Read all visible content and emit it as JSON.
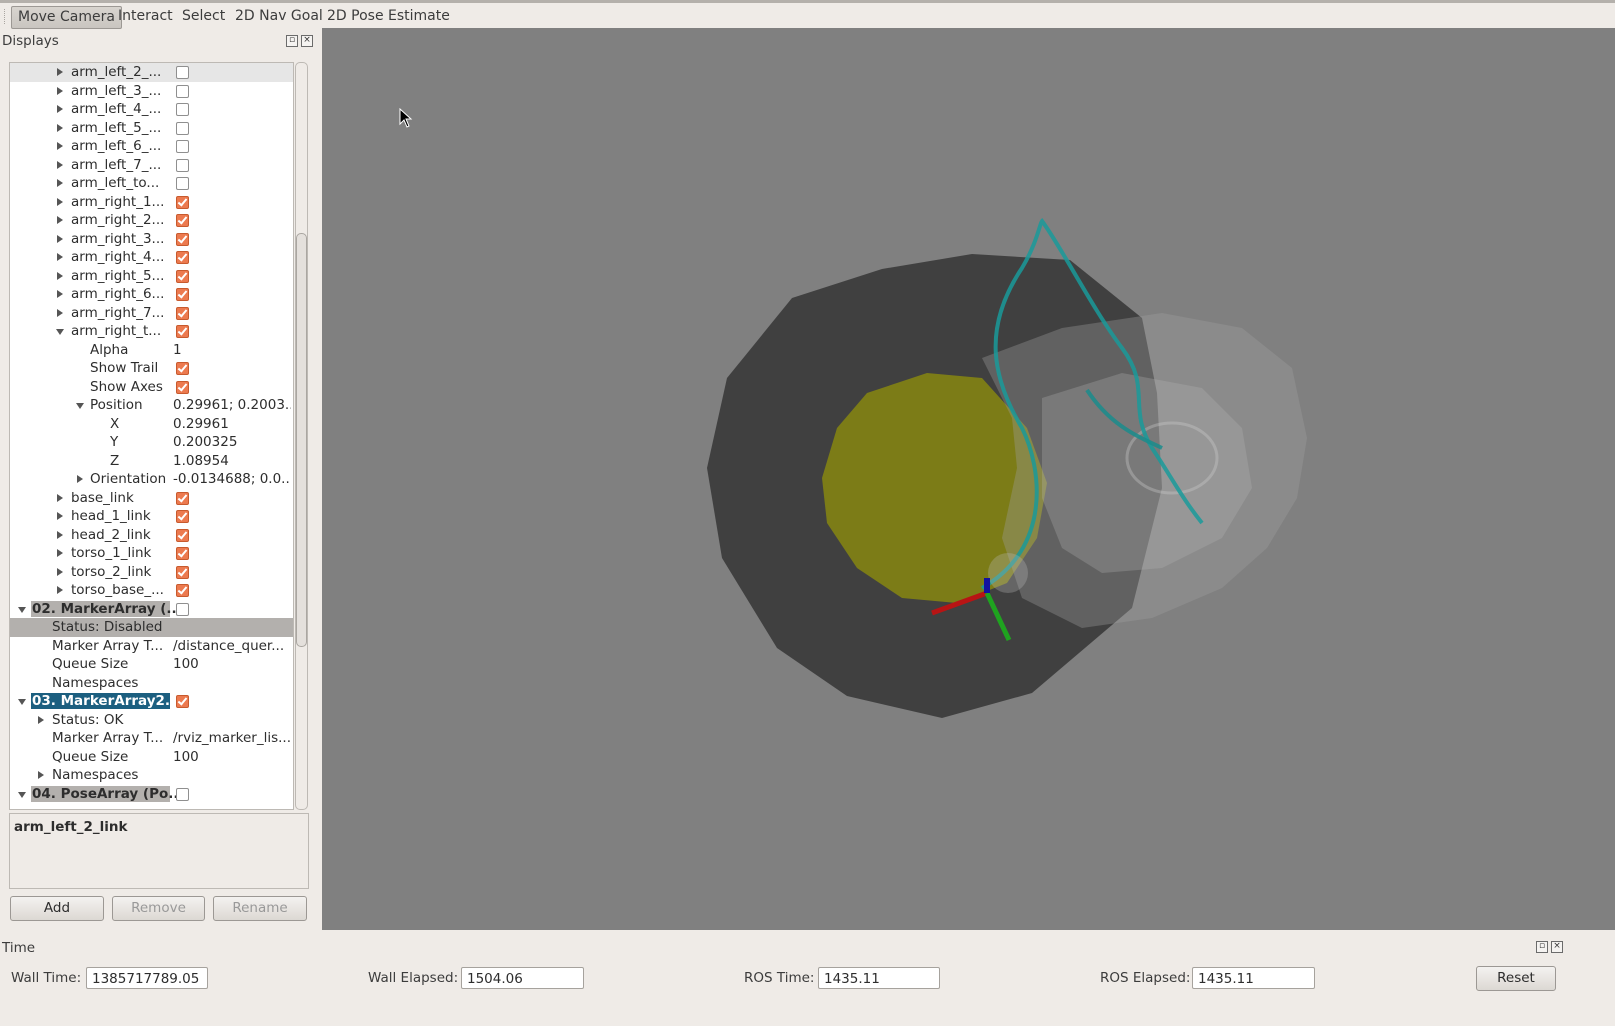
{
  "toolbar": {
    "tools": [
      "Move Camera",
      "Interact",
      "Select",
      "2D Nav Goal",
      "2D Pose Estimate"
    ]
  },
  "displays": {
    "title": "Displays",
    "rows": [
      {
        "label": "arm_left_2_...",
        "checked": false
      },
      {
        "label": "arm_left_3_...",
        "checked": false
      },
      {
        "label": "arm_left_4_...",
        "checked": false
      },
      {
        "label": "arm_left_5_...",
        "checked": false
      },
      {
        "label": "arm_left_6_...",
        "checked": false
      },
      {
        "label": "arm_left_7_...",
        "checked": false
      },
      {
        "label": "arm_left_to...",
        "checked": false
      },
      {
        "label": "arm_right_1...",
        "checked": true
      },
      {
        "label": "arm_right_2...",
        "checked": true
      },
      {
        "label": "arm_right_3...",
        "checked": true
      },
      {
        "label": "arm_right_4...",
        "checked": true
      },
      {
        "label": "arm_right_5...",
        "checked": true
      },
      {
        "label": "arm_right_6...",
        "checked": true
      },
      {
        "label": "arm_right_7...",
        "checked": true
      },
      {
        "label": "arm_right_t...",
        "checked": true
      },
      {
        "label": "Alpha",
        "value": "1"
      },
      {
        "label": "Show Trail",
        "checked": true
      },
      {
        "label": "Show Axes",
        "checked": true
      },
      {
        "label": "Position",
        "value": "0.29961; 0.2003..."
      },
      {
        "label": "X",
        "value": "0.29961"
      },
      {
        "label": "Y",
        "value": "0.200325"
      },
      {
        "label": "Z",
        "value": "1.08954"
      },
      {
        "label": "Orientation",
        "value": "-0.0134688; 0.0..."
      },
      {
        "label": "base_link",
        "checked": true
      },
      {
        "label": "head_1_link",
        "checked": true
      },
      {
        "label": "head_2_link",
        "checked": true
      },
      {
        "label": "torso_1_link",
        "checked": true
      },
      {
        "label": "torso_2_link",
        "checked": true
      },
      {
        "label": "torso_base_...",
        "checked": true
      },
      {
        "label": "02. MarkerArray (...",
        "checked": false
      },
      {
        "label": "Status: Disabled"
      },
      {
        "label": "Marker Array T...",
        "value": "/distance_quer..."
      },
      {
        "label": "Queue Size",
        "value": "100"
      },
      {
        "label": "Namespaces"
      },
      {
        "label": "03. MarkerArray2...",
        "checked": true
      },
      {
        "label": "Status: OK"
      },
      {
        "label": "Marker Array T...",
        "value": "/rviz_marker_lis..."
      },
      {
        "label": "Queue Size",
        "value": "100"
      },
      {
        "label": "Namespaces"
      },
      {
        "label": "04. PoseArray (Po...",
        "checked": false
      }
    ],
    "description": "arm_left_2_link",
    "buttons": {
      "add": "Add",
      "remove": "Remove",
      "rename": "Rename"
    }
  },
  "time": {
    "title": "Time",
    "wall_time_label": "Wall Time:",
    "wall_time": "1385717789.05",
    "wall_elapsed_label": "Wall Elapsed:",
    "wall_elapsed": "1504.06",
    "ros_time_label": "ROS Time:",
    "ros_time": "1435.11",
    "ros_elapsed_label": "ROS Elapsed:",
    "ros_elapsed": "1435.11",
    "reset_label": "Reset"
  }
}
